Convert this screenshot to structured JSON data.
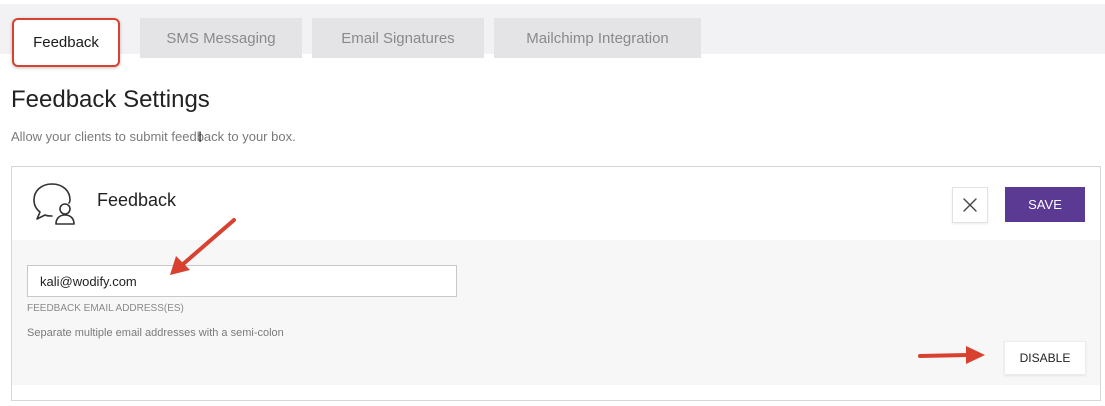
{
  "tabs": [
    {
      "label": "Feedback",
      "active": true
    },
    {
      "label": "SMS Messaging",
      "active": false
    },
    {
      "label": "Email Signatures",
      "active": false
    },
    {
      "label": "Mailchimp Integration",
      "active": false
    }
  ],
  "page": {
    "title": "Feedback Settings",
    "subtitle": "Allow your clients to submit feedback to your box."
  },
  "card": {
    "icon": "chat-bubble-person-icon",
    "title": "Feedback",
    "close_icon": "close-icon",
    "save_label": "SAVE",
    "email_value": "kali@wodify.com",
    "email_label": "FEEDBACK EMAIL ADDRESS(ES)",
    "help_text": "Separate multiple email addresses with a semi-colon",
    "disable_label": "DISABLE"
  },
  "colors": {
    "accent": "#5b3a94",
    "annotation": "#d8412f",
    "tab_bar": "#f2f2f4"
  }
}
